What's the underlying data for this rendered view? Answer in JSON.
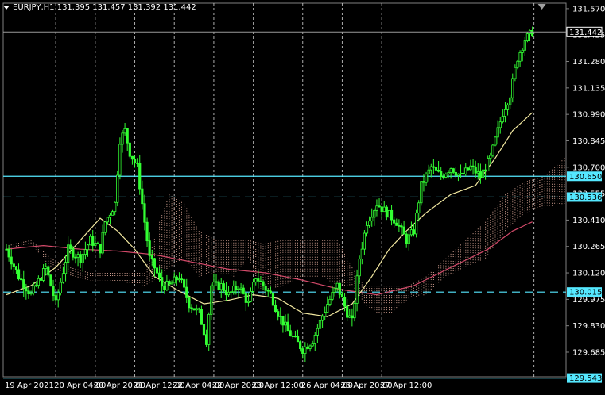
{
  "header": {
    "symbol": "EURJPY,H1",
    "open": "131.395",
    "high": "131.457",
    "low": "131.392",
    "close": "131.442"
  },
  "colors": {
    "background": "#000000",
    "candle": "#33ff33",
    "grid": "#d8d8d8",
    "ma_fast": "#f2e8a0",
    "ma_slow": "#d44a6a",
    "cloud": "#e8b0a0",
    "level": "#55e8ff",
    "axis_text": "#ffffff"
  },
  "chart_data": {
    "type": "candlestick",
    "symbol": "EURJPY",
    "timeframe": "H1",
    "ylim": [
      129.55,
      131.6
    ],
    "y_ticks": [
      "131.570",
      "131.425",
      "131.280",
      "131.135",
      "130.990",
      "130.845",
      "130.700",
      "130.555",
      "130.410",
      "130.265",
      "130.120",
      "129.975",
      "129.830",
      "129.685"
    ],
    "x_ticks": [
      "19 Apr 2021",
      "20 Apr 04:00",
      "20 Apr 20:00",
      "21 Apr 12:00",
      "22 Apr 04:00",
      "22 Apr 20:00",
      "23 Apr 12:00",
      "26 Apr 04:00",
      "26 Apr 20:00",
      "27 Apr 12:00"
    ],
    "current_price": {
      "value": 131.442,
      "label": "131.442"
    },
    "levels": [
      {
        "value": 130.65,
        "label": "130.650",
        "style": "solid"
      },
      {
        "value": 130.536,
        "label": "130.536",
        "style": "dashed"
      },
      {
        "value": 130.015,
        "label": "130.015",
        "style": "dashed"
      },
      {
        "value": 129.543,
        "label": "129.543",
        "style": "solid"
      }
    ],
    "close_path": [
      [
        0,
        130.25
      ],
      [
        5,
        130.1
      ],
      [
        10,
        130.0
      ],
      [
        16,
        130.15
      ],
      [
        20,
        129.95
      ],
      [
        25,
        130.25
      ],
      [
        30,
        130.2
      ],
      [
        34,
        130.3
      ],
      [
        38,
        130.25
      ],
      [
        40,
        130.4
      ],
      [
        44,
        130.5
      ],
      [
        46,
        130.85
      ],
      [
        48,
        130.9
      ],
      [
        50,
        130.78
      ],
      [
        53,
        130.7
      ],
      [
        55,
        130.5
      ],
      [
        58,
        130.2
      ],
      [
        60,
        130.15
      ],
      [
        63,
        130.05
      ],
      [
        66,
        130.05
      ],
      [
        70,
        130.1
      ],
      [
        74,
        129.95
      ],
      [
        78,
        129.9
      ],
      [
        81,
        129.75
      ],
      [
        83,
        130.05
      ],
      [
        87,
        130.05
      ],
      [
        90,
        130.0
      ],
      [
        94,
        130.05
      ],
      [
        98,
        129.95
      ],
      [
        101,
        130.1
      ],
      [
        104,
        130.05
      ],
      [
        107,
        130.0
      ],
      [
        110,
        129.9
      ],
      [
        114,
        129.8
      ],
      [
        117,
        129.75
      ],
      [
        120,
        129.7
      ],
      [
        124,
        129.75
      ],
      [
        127,
        129.85
      ],
      [
        130,
        129.95
      ],
      [
        134,
        130.05
      ],
      [
        138,
        129.9
      ],
      [
        140,
        129.85
      ],
      [
        143,
        130.2
      ],
      [
        146,
        130.4
      ],
      [
        150,
        130.5
      ],
      [
        154,
        130.45
      ],
      [
        158,
        130.4
      ],
      [
        162,
        130.3
      ],
      [
        165,
        130.35
      ],
      [
        168,
        130.6
      ],
      [
        172,
        130.7
      ],
      [
        176,
        130.65
      ],
      [
        180,
        130.7
      ],
      [
        184,
        130.65
      ],
      [
        188,
        130.7
      ],
      [
        192,
        130.65
      ],
      [
        196,
        130.75
      ],
      [
        199,
        130.9
      ],
      [
        201,
        131.0
      ],
      [
        204,
        131.1
      ],
      [
        207,
        131.3
      ],
      [
        210,
        131.4
      ],
      [
        213,
        131.44
      ]
    ],
    "ma_fast": [
      [
        0,
        130.0
      ],
      [
        10,
        130.05
      ],
      [
        20,
        130.15
      ],
      [
        30,
        130.3
      ],
      [
        38,
        130.42
      ],
      [
        45,
        130.35
      ],
      [
        52,
        130.25
      ],
      [
        60,
        130.1
      ],
      [
        70,
        130.02
      ],
      [
        80,
        129.95
      ],
      [
        90,
        129.97
      ],
      [
        100,
        130.0
      ],
      [
        110,
        129.98
      ],
      [
        120,
        129.9
      ],
      [
        130,
        129.88
      ],
      [
        140,
        129.95
      ],
      [
        148,
        130.1
      ],
      [
        155,
        130.25
      ],
      [
        162,
        130.35
      ],
      [
        170,
        130.45
      ],
      [
        180,
        130.55
      ],
      [
        190,
        130.6
      ],
      [
        198,
        130.75
      ],
      [
        205,
        130.9
      ],
      [
        213,
        131.0
      ]
    ],
    "ma_slow": [
      [
        0,
        130.25
      ],
      [
        15,
        130.27
      ],
      [
        30,
        130.25
      ],
      [
        45,
        130.24
      ],
      [
        60,
        130.22
      ],
      [
        75,
        130.18
      ],
      [
        90,
        130.14
      ],
      [
        105,
        130.12
      ],
      [
        120,
        130.08
      ],
      [
        135,
        130.03
      ],
      [
        150,
        130.0
      ],
      [
        165,
        130.05
      ],
      [
        180,
        130.15
      ],
      [
        195,
        130.25
      ],
      [
        205,
        130.35
      ],
      [
        213,
        130.4
      ]
    ],
    "cloud": [
      [
        0,
        130.27,
        130.25
      ],
      [
        10,
        130.3,
        130.28
      ],
      [
        18,
        130.2,
        130.15
      ],
      [
        26,
        130.15,
        130.1
      ],
      [
        34,
        130.12,
        130.08
      ],
      [
        42,
        130.12,
        130.08
      ],
      [
        52,
        130.12,
        130.06
      ],
      [
        56,
        130.12,
        130.05
      ],
      [
        62,
        130.4,
        130.1
      ],
      [
        66,
        130.55,
        130.15
      ],
      [
        72,
        130.5,
        130.2
      ],
      [
        78,
        130.35,
        130.1
      ],
      [
        85,
        130.3,
        130.12
      ],
      [
        92,
        130.3,
        130.1
      ],
      [
        98,
        130.3,
        130.2
      ],
      [
        104,
        130.28,
        130.0
      ],
      [
        112,
        130.3,
        130.05
      ],
      [
        120,
        130.3,
        130.1
      ],
      [
        128,
        130.3,
        130.1
      ],
      [
        134,
        130.3,
        130.05
      ],
      [
        140,
        130.15,
        130.05
      ],
      [
        145,
        130.05,
        129.95
      ],
      [
        150,
        130.05,
        129.9
      ],
      [
        156,
        130.05,
        129.9
      ],
      [
        163,
        130.05,
        129.98
      ],
      [
        170,
        130.1,
        130.0
      ],
      [
        178,
        130.2,
        130.1
      ],
      [
        186,
        130.3,
        130.15
      ],
      [
        194,
        130.4,
        130.2
      ],
      [
        202,
        130.55,
        130.35
      ],
      [
        210,
        130.62,
        130.45
      ],
      [
        218,
        130.65,
        130.48
      ],
      [
        226,
        130.75,
        130.5
      ]
    ]
  }
}
